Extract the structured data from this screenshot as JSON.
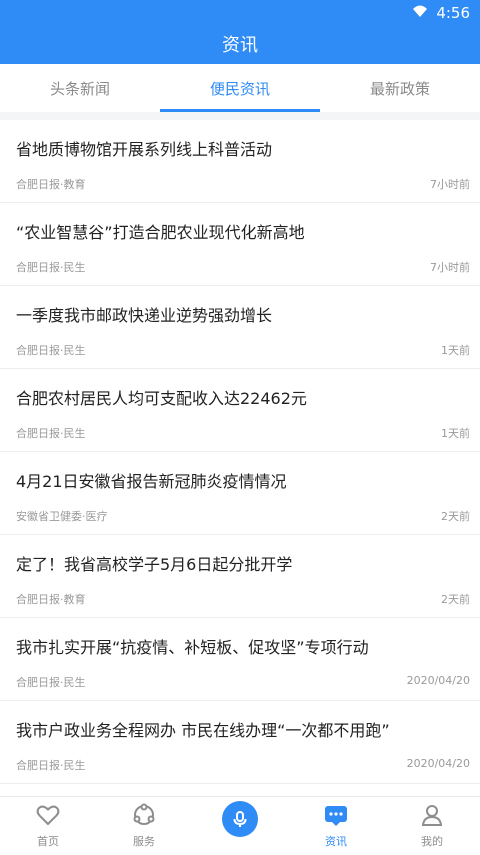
{
  "status_bar": {
    "time": "4:56"
  },
  "header": {
    "title": "资讯"
  },
  "tabs": [
    {
      "label": "头条新闻"
    },
    {
      "label": "便民资讯"
    },
    {
      "label": "最新政策"
    }
  ],
  "active_tab": "便民资讯",
  "news": [
    {
      "title": "省地质博物馆开展系列线上科普活动",
      "source": "合肥日报·教育",
      "time": "7小时前"
    },
    {
      "title": "“农业智慧谷”打造合肥农业现代化新高地",
      "source": "合肥日报·民生",
      "time": "7小时前"
    },
    {
      "title": "一季度我市邮政快递业逆势强劲增长",
      "source": "合肥日报·民生",
      "time": "1天前"
    },
    {
      "title": "合肥农村居民人均可支配收入达22462元",
      "source": "合肥日报·民生",
      "time": "1天前"
    },
    {
      "title": "4月21日安徽省报告新冠肺炎疫情情况",
      "source": "安徽省卫健委·医疗",
      "time": "2天前"
    },
    {
      "title": "定了！我省高校学子5月6日起分批开学",
      "source": "合肥日报·教育",
      "time": "2天前"
    },
    {
      "title": "我市扎实开展“抗疫情、补短板、促攻坚”专项行动",
      "source": "合肥日报·民生",
      "time": "2020/04/20"
    },
    {
      "title": "我市户政业务全程网办 市民在线办理“一次都不用跑”",
      "source": "合肥日报·民生",
      "time": "2020/04/20"
    }
  ],
  "bottom_nav": [
    {
      "label": "首页",
      "icon": "heart-icon"
    },
    {
      "label": "服务",
      "icon": "service-icon"
    },
    {
      "label": "",
      "icon": "microphone-icon"
    },
    {
      "label": "资讯",
      "icon": "chat-icon"
    },
    {
      "label": "我的",
      "icon": "user-icon"
    }
  ],
  "colors": {
    "primary": "#2f8bf5"
  }
}
